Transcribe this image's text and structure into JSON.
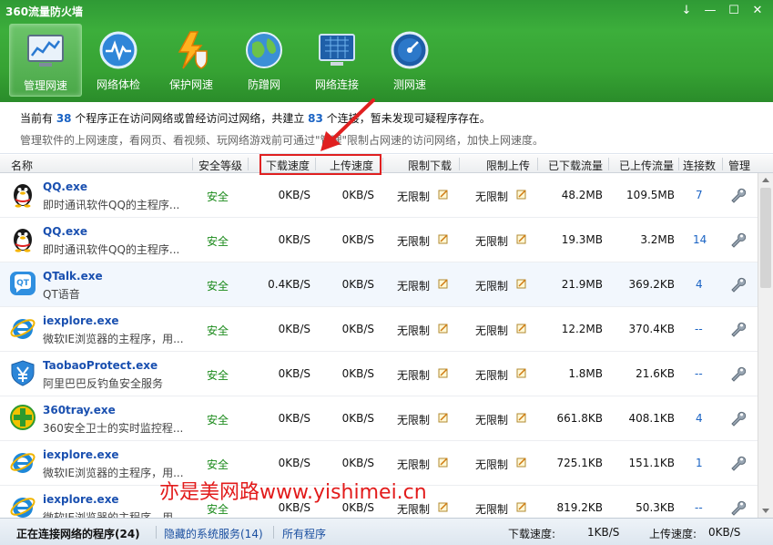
{
  "window": {
    "title": "360流量防火墙",
    "controls": [
      "↓",
      "—",
      "☐",
      "✕"
    ]
  },
  "toolbar": [
    {
      "label": "管理网速",
      "icon": "monitor-chart-icon",
      "active": true
    },
    {
      "label": "网络体检",
      "icon": "pulse-check-icon",
      "active": false
    },
    {
      "label": "保护网速",
      "icon": "lightning-shield-icon",
      "active": false
    },
    {
      "label": "防蹭网",
      "icon": "globe-icon",
      "active": false
    },
    {
      "label": "网络连接",
      "icon": "network-connection-icon",
      "active": false
    },
    {
      "label": "测网速",
      "icon": "speedometer-icon",
      "active": false
    }
  ],
  "info": {
    "line1_a": "当前有 ",
    "programs": "38",
    "line1_b": " 个程序正在访问网络或曾经访问过网络，共建立 ",
    "connections": "83",
    "line1_c": " 个连接，暂未发现可疑程序存在。",
    "line2": "管理软件的上网速度，看网页、看视频、玩网络游戏前可通过\"管理\"限制占网速的访问网络，加快上网速度。"
  },
  "table": {
    "headers": [
      "名称",
      "安全等级",
      "下载速度",
      "上传速度",
      "限制下载",
      "限制上传",
      "已下载流量",
      "已上传流量",
      "连接数",
      "管理"
    ],
    "rows": [
      {
        "icon": "qq-penguin-icon",
        "name": "QQ.exe",
        "desc": "即时通讯软件QQ的主程序...",
        "safety": "安全",
        "down": "0KB/S",
        "up": "0KB/S",
        "limit_down": "无限制",
        "limit_up": "无限制",
        "downloaded": "48.2MB",
        "uploaded": "109.5MB",
        "conn": "7"
      },
      {
        "icon": "qq-penguin-icon",
        "name": "QQ.exe",
        "desc": "即时通讯软件QQ的主程序...",
        "safety": "安全",
        "down": "0KB/S",
        "up": "0KB/S",
        "limit_down": "无限制",
        "limit_up": "无限制",
        "downloaded": "19.3MB",
        "uploaded": "3.2MB",
        "conn": "14"
      },
      {
        "icon": "qtalk-icon",
        "name": "QTalk.exe",
        "desc": "QT语音",
        "safety": "安全",
        "down": "0.4KB/S",
        "up": "0KB/S",
        "limit_down": "无限制",
        "limit_up": "无限制",
        "downloaded": "21.9MB",
        "uploaded": "369.2KB",
        "conn": "4"
      },
      {
        "icon": "ie-icon",
        "name": "iexplore.exe",
        "desc": "微软IE浏览器的主程序，用...",
        "safety": "安全",
        "down": "0KB/S",
        "up": "0KB/S",
        "limit_down": "无限制",
        "limit_up": "无限制",
        "downloaded": "12.2MB",
        "uploaded": "370.4KB",
        "conn": "--"
      },
      {
        "icon": "taobao-protect-icon",
        "name": "TaobaoProtect.exe",
        "desc": "阿里巴巴反钓鱼安全服务",
        "safety": "安全",
        "down": "0KB/S",
        "up": "0KB/S",
        "limit_down": "无限制",
        "limit_up": "无限制",
        "downloaded": "1.8MB",
        "uploaded": "21.6KB",
        "conn": "--"
      },
      {
        "icon": "360-tray-icon",
        "name": "360tray.exe",
        "desc": "360安全卫士的实时监控程...",
        "safety": "安全",
        "down": "0KB/S",
        "up": "0KB/S",
        "limit_down": "无限制",
        "limit_up": "无限制",
        "downloaded": "661.8KB",
        "uploaded": "408.1KB",
        "conn": "4"
      },
      {
        "icon": "ie-icon",
        "name": "iexplore.exe",
        "desc": "微软IE浏览器的主程序，用...",
        "safety": "安全",
        "down": "0KB/S",
        "up": "0KB/S",
        "limit_down": "无限制",
        "limit_up": "无限制",
        "downloaded": "725.1KB",
        "uploaded": "151.1KB",
        "conn": "1"
      },
      {
        "icon": "ie-icon",
        "name": "iexplore.exe",
        "desc": "微软IE浏览器的主程序，用...",
        "safety": "安全",
        "down": "0KB/S",
        "up": "0KB/S",
        "limit_down": "无限制",
        "limit_up": "无限制",
        "downloaded": "819.2KB",
        "uploaded": "50.3KB",
        "conn": "--"
      }
    ]
  },
  "bottom": {
    "tab_active": "正在连接网络的程序(24)",
    "tab_hidden": "隐藏的系统服务(14)",
    "tab_all": "所有程序",
    "down_label": "下载速度:",
    "down_value": "1KB/S",
    "up_label": "上传速度:",
    "up_value": "0KB/S"
  },
  "watermark": "亦是美网路www.yishimei.cn",
  "colors": {
    "accent_green": "#36a233",
    "link_blue": "#1a63c4",
    "safe_green": "#1b8a1b",
    "annotation_red": "#e02020"
  }
}
